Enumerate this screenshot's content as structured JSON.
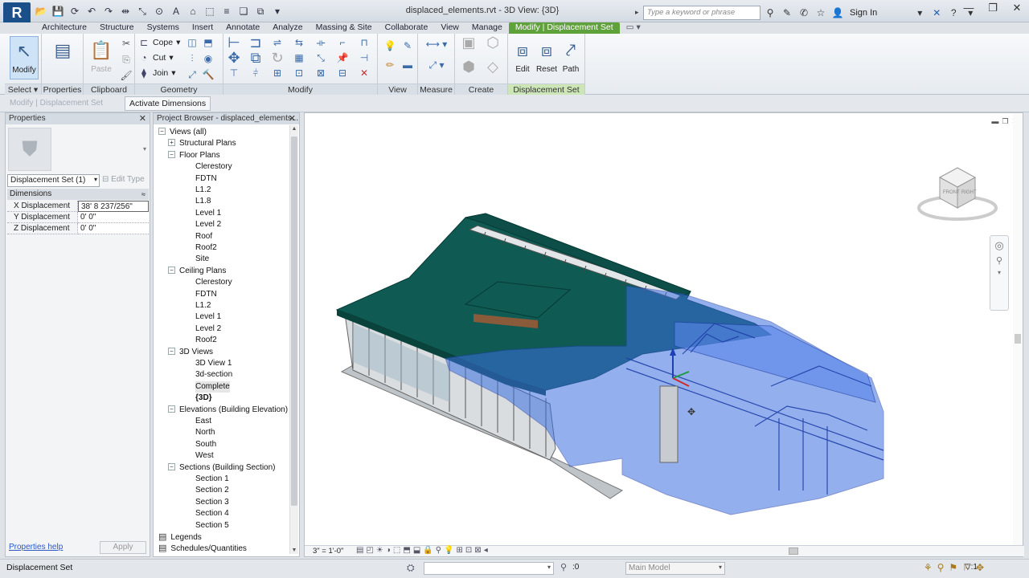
{
  "window": {
    "app_logo": "R",
    "doc_title": "displaced_elements.rvt - 3D View: {3D}",
    "search_placeholder": "Type a keyword or phrase",
    "sign_in": "Sign In",
    "minimize": "—",
    "maximize": "❐",
    "close": "✕"
  },
  "tabs": [
    "Architecture",
    "Structure",
    "Systems",
    "Insert",
    "Annotate",
    "Analyze",
    "Massing & Site",
    "Collaborate",
    "View",
    "Manage"
  ],
  "context_tab": "Modify | Displacement Set",
  "ribbon": {
    "select": {
      "label": "Select",
      "modify": "Modify"
    },
    "properties": {
      "label": "Properties"
    },
    "clipboard": {
      "label": "Clipboard",
      "paste": "Paste"
    },
    "geometry": {
      "label": "Geometry",
      "cope": "Cope",
      "cut": "Cut",
      "join": "Join"
    },
    "modify": {
      "label": "Modify"
    },
    "view": {
      "label": "View"
    },
    "measure": {
      "label": "Measure"
    },
    "create": {
      "label": "Create"
    },
    "displacement_set": {
      "label": "Displacement Set",
      "edit": "Edit",
      "reset": "Reset",
      "path": "Path"
    }
  },
  "options_bar": {
    "context": "Modify | Displacement Set",
    "activate_dimensions": "Activate Dimensions"
  },
  "properties": {
    "title": "Properties",
    "type_selector": "Displacement Set (1)",
    "edit_type": "Edit Type",
    "group": "Dimensions",
    "rows": [
      {
        "name": "X Displacement",
        "value": "38'  8 237/256\""
      },
      {
        "name": "Y Displacement",
        "value": "0'  0\""
      },
      {
        "name": "Z Displacement",
        "value": "0'  0\""
      }
    ],
    "help_link": "Properties help",
    "apply": "Apply"
  },
  "browser": {
    "title": "Project Browser - displaced_elements...",
    "nodes": [
      {
        "text": "Views (all)",
        "level": 0,
        "toggle": "−"
      },
      {
        "text": "Structural Plans",
        "level": 1,
        "toggle": "+"
      },
      {
        "text": "Floor Plans",
        "level": 1,
        "toggle": "−"
      },
      {
        "text": "Clerestory",
        "level": 2
      },
      {
        "text": "FDTN",
        "level": 2
      },
      {
        "text": "L1.2",
        "level": 2
      },
      {
        "text": "L1.8",
        "level": 2
      },
      {
        "text": "Level 1",
        "level": 2
      },
      {
        "text": "Level 2",
        "level": 2
      },
      {
        "text": "Roof",
        "level": 2
      },
      {
        "text": "Roof2",
        "level": 2
      },
      {
        "text": "Site",
        "level": 2
      },
      {
        "text": "Ceiling Plans",
        "level": 1,
        "toggle": "−"
      },
      {
        "text": "Clerestory",
        "level": 2
      },
      {
        "text": "FDTN",
        "level": 2
      },
      {
        "text": "L1.2",
        "level": 2
      },
      {
        "text": "Level 1",
        "level": 2
      },
      {
        "text": "Level 2",
        "level": 2
      },
      {
        "text": "Roof2",
        "level": 2
      },
      {
        "text": "3D Views",
        "level": 1,
        "toggle": "−"
      },
      {
        "text": "3D View 1",
        "level": 2
      },
      {
        "text": "3d-section",
        "level": 2
      },
      {
        "text": "Complete",
        "level": 2,
        "selected": true
      },
      {
        "text": "{3D}",
        "level": 2,
        "bold": true
      },
      {
        "text": "Elevations (Building Elevation)",
        "level": 1,
        "toggle": "−"
      },
      {
        "text": "East",
        "level": 2
      },
      {
        "text": "North",
        "level": 2
      },
      {
        "text": "South",
        "level": 2
      },
      {
        "text": "West",
        "level": 2
      },
      {
        "text": "Sections (Building Section)",
        "level": 1,
        "toggle": "−"
      },
      {
        "text": "Section 1",
        "level": 2
      },
      {
        "text": "Section 2",
        "level": 2
      },
      {
        "text": "Section 3",
        "level": 2
      },
      {
        "text": "Section 4",
        "level": 2
      },
      {
        "text": "Section 5",
        "level": 2
      },
      {
        "text": "Legends",
        "level": 0,
        "icon": true
      },
      {
        "text": "Schedules/Quantities",
        "level": 0,
        "icon": true
      }
    ]
  },
  "viewport": {
    "viewcube_front": "FRONT",
    "viewcube_right": "RIGHT",
    "scale": "3\" = 1'-0\""
  },
  "status": {
    "text": "Displacement Set",
    "count": ":0",
    "model": "Main Model",
    "filter_count": ":1"
  },
  "colors": {
    "roof": "#0f5a52",
    "displaced": "#3b6fe0",
    "context_tab": "#5fa13b"
  }
}
